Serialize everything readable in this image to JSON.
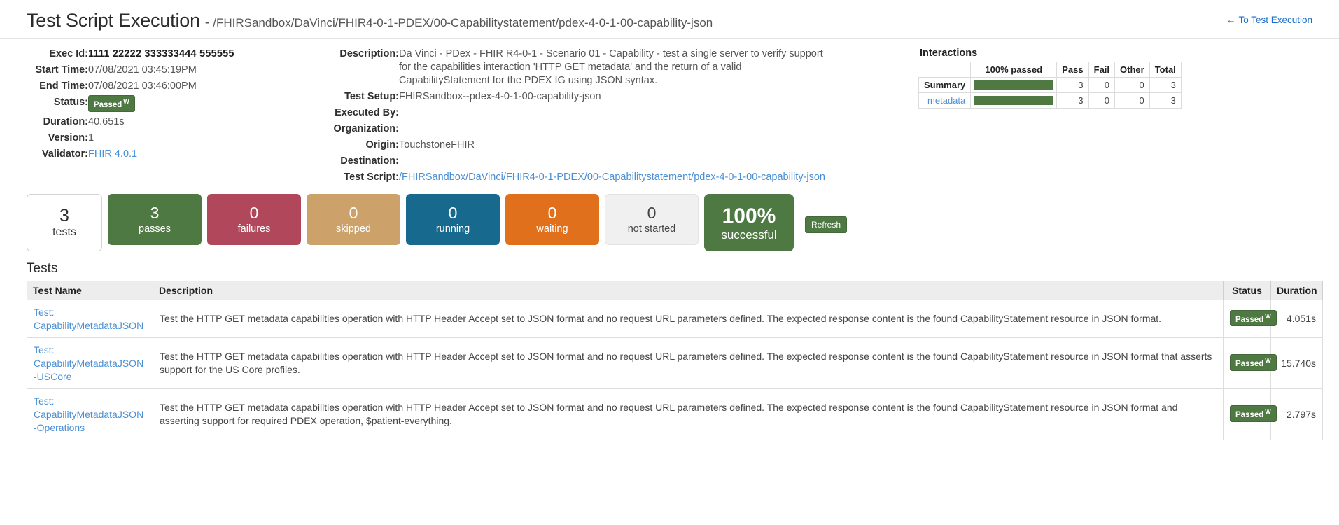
{
  "header": {
    "title": "Test Script Execution",
    "separator": "-",
    "subtitle": "/FHIRSandbox/DaVinci/FHIR4-0-1-PDEX/00-Capabilitystatement/pdex-4-0-1-00-capability-json",
    "back_link": "To Test Execution",
    "back_arrow": "←"
  },
  "details_left": {
    "exec_id_label": "Exec Id:",
    "exec_id_value": "1111 22222 333333444 555555",
    "start_time_label": "Start Time:",
    "start_time_value": "07/08/2021 03:45:19PM",
    "end_time_label": "End Time:",
    "end_time_value": "07/08/2021 03:46:00PM",
    "status_label": "Status:",
    "status_value": "Passed",
    "status_sup": "W",
    "duration_label": "Duration:",
    "duration_value": "40.651s",
    "version_label": "Version:",
    "version_value": "1",
    "validator_label": "Validator:",
    "validator_value": "FHIR 4.0.1"
  },
  "details_mid": {
    "description_label": "Description:",
    "description_value": "Da Vinci - PDex - FHIR R4-0-1 - Scenario 01 - Capability - test a single server to verify support for the capabilities interaction 'HTTP GET metadata' and the return of a valid CapabilityStatement for the PDEX IG using JSON syntax.",
    "test_setup_label": "Test Setup:",
    "test_setup_value": "FHIRSandbox--pdex-4-0-1-00-capability-json",
    "executed_by_label": "Executed By:",
    "executed_by_value": "",
    "organization_label": "Organization:",
    "organization_value": "",
    "origin_label": "Origin:",
    "origin_value": "TouchstoneFHIR",
    "destination_label": "Destination:",
    "destination_value": "",
    "test_script_label": "Test Script:",
    "test_script_value": "/FHIRSandbox/DaVinci/FHIR4-0-1-PDEX/00-Capabilitystatement/pdex-4-0-1-00-capability-json"
  },
  "interactions": {
    "title": "Interactions",
    "columns": [
      "",
      "100% passed",
      "Pass",
      "Fail",
      "Other",
      "Total"
    ],
    "rows": [
      {
        "name": "Summary",
        "is_link": false,
        "percent": 100,
        "pass": "3",
        "fail": "0",
        "other": "0",
        "total": "3"
      },
      {
        "name": "metadata",
        "is_link": true,
        "percent": 100,
        "pass": "3",
        "fail": "0",
        "other": "0",
        "total": "3"
      }
    ],
    "bar_color": "#4f7942"
  },
  "stats": [
    {
      "num": "3",
      "label": "tests",
      "kind": "tests",
      "color": "#ffffff"
    },
    {
      "num": "3",
      "label": "passes",
      "kind": "passes",
      "color": "#4f7942"
    },
    {
      "num": "0",
      "label": "failures",
      "kind": "failures",
      "color": "#b0475a"
    },
    {
      "num": "0",
      "label": "skipped",
      "kind": "skipped",
      "color": "#cda16a"
    },
    {
      "num": "0",
      "label": "running",
      "kind": "running",
      "color": "#176a8e"
    },
    {
      "num": "0",
      "label": "waiting",
      "kind": "waiting",
      "color": "#e0701c"
    },
    {
      "num": "0",
      "label": "not started",
      "kind": "notstarted",
      "color": "#f0f0f0"
    }
  ],
  "success_box": {
    "num": "100%",
    "label": "successful",
    "color": "#4f7942"
  },
  "refresh_label": "Refresh",
  "tests_section": {
    "heading": "Tests",
    "columns": [
      "Test Name",
      "Description",
      "Status",
      "Duration"
    ],
    "rows": [
      {
        "name_prefix": "Test:",
        "name": "CapabilityMetadataJSON",
        "description": "Test the HTTP GET metadata capabilities operation with HTTP Header Accept set to JSON format and no request URL parameters defined. The expected response content is the found CapabilityStatement resource in JSON format.",
        "status": "Passed",
        "status_sup": "W",
        "duration": "4.051s"
      },
      {
        "name_prefix": "Test:",
        "name": "CapabilityMetadataJSON-USCore",
        "description": "Test the HTTP GET metadata capabilities operation with HTTP Header Accept set to JSON format and no request URL parameters defined. The expected response content is the found CapabilityStatement resource in JSON format that asserts support for the US Core profiles.",
        "status": "Passed",
        "status_sup": "W",
        "duration": "15.740s"
      },
      {
        "name_prefix": "Test:",
        "name": "CapabilityMetadataJSON-Operations",
        "description": "Test the HTTP GET metadata capabilities operation with HTTP Header Accept set to JSON format and no request URL parameters defined. The expected response content is the found CapabilityStatement resource in JSON format and asserting support for required PDEX operation, $patient-everything.",
        "status": "Passed",
        "status_sup": "W",
        "duration": "2.797s"
      }
    ]
  }
}
